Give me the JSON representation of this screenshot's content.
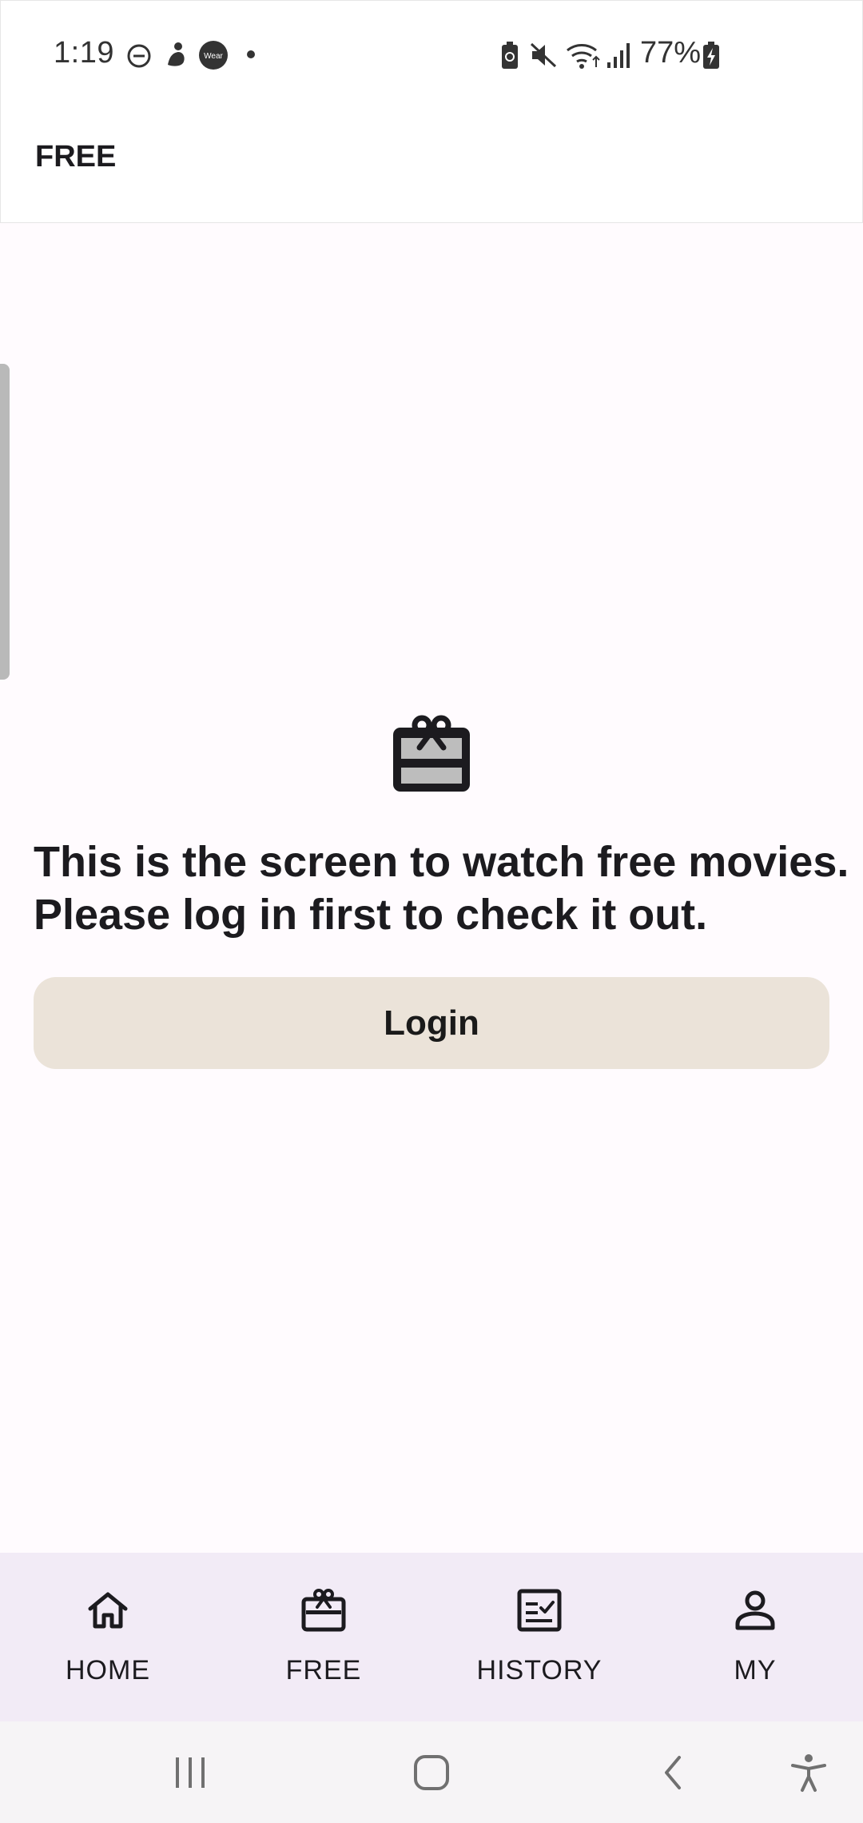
{
  "status_bar": {
    "time": "1:19",
    "battery_percent": "77%",
    "icons": [
      "do-not-disturb-icon",
      "samsung-health-icon",
      "wear-app-icon",
      "notification-dot-icon",
      "battery-saver-icon",
      "mute-icon",
      "wifi-icon",
      "cell-signal-icon",
      "battery-charging-icon"
    ],
    "wear_badge_text": "Wear"
  },
  "app_bar": {
    "title": "FREE"
  },
  "content": {
    "hero_icon": "gift-card-icon",
    "message_line_1": "This is the screen to watch free movies.",
    "message_line_2": "Please log in first to check it out.",
    "login_label": "Login"
  },
  "bottom_nav": {
    "items": [
      {
        "label": "HOME",
        "icon": "home-icon"
      },
      {
        "label": "FREE",
        "icon": "gift-card-icon",
        "selected": true
      },
      {
        "label": "HISTORY",
        "icon": "history-list-icon"
      },
      {
        "label": "MY",
        "icon": "person-icon"
      }
    ]
  },
  "system_nav": {
    "buttons": [
      "recents-icon",
      "home-circle-icon",
      "back-icon",
      "accessibility-icon"
    ]
  },
  "colors": {
    "background": "#fffbfe",
    "login_button": "#ebe3d9",
    "bottom_nav": "#f2ebf6",
    "text": "#1c1b1f"
  }
}
